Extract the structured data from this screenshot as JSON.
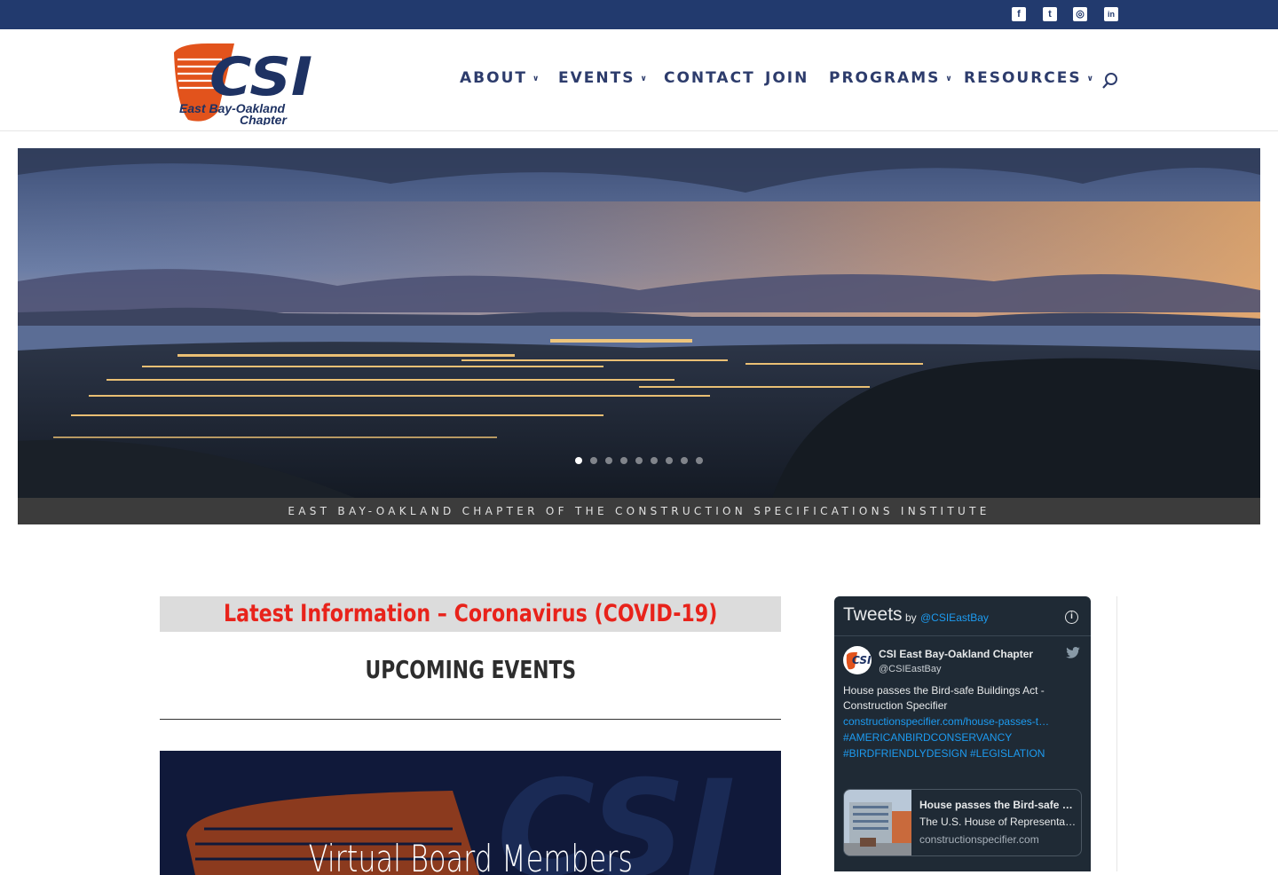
{
  "social_links": [
    {
      "icon": "facebook-icon",
      "glyph": "f"
    },
    {
      "icon": "twitter-icon",
      "glyph": "t"
    },
    {
      "icon": "instagram-icon",
      "glyph": "◎"
    },
    {
      "icon": "linkedin-icon",
      "glyph": "in"
    }
  ],
  "logo": {
    "acronym": "CSI",
    "line1": "East Bay-Oakland",
    "line2": "Chapter"
  },
  "nav": {
    "about": "ABOUT",
    "events": "EVENTS",
    "contact": "CONTACT",
    "join": "JOIN",
    "programs": "PROGRAMS",
    "resources": "RESOURCES",
    "chevron": "∨"
  },
  "hero": {
    "slide_count": 9,
    "active_slide": 1,
    "caption": "EAST BAY-OAKLAND CHAPTER OF THE CONSTRUCTION SPECIFICATIONS INSTITUTE"
  },
  "main": {
    "alert": "Latest Information – Coronavirus (COVID-19)",
    "upcoming_heading": "UPCOMING EVENTS",
    "event_title": "Virtual Board Members"
  },
  "twitter": {
    "title": "Tweets",
    "by": "by",
    "handle_link": "@CSIEastBay",
    "account_name": "CSI East Bay-Oakland Chapter",
    "account_handle": "@CSIEastBay",
    "tweet_text": "House passes the Bird-safe Buildings Act - Construction Specifier",
    "tweet_url": "constructionspecifier.com/house-passes-t…",
    "hashtag1": "#AMERICANBIRDCONSERVANCY",
    "hashtag2": "#BIRDFRIENDLYDESIGN",
    "hashtag3": "#LEGISLATION",
    "card_title": "House passes the Bird-safe Buildings Act - Construction Specifier",
    "card_desc": "The U.S. House of Representatives passed the Bird-safe Buildings Act",
    "card_domain": "constructionspecifier.com"
  },
  "colors": {
    "topbar": "#223a6e",
    "nav_text": "#2d3c6c",
    "alert_text": "#e8231b",
    "twitter_bg": "#1f2a35",
    "twitter_link": "#1d9bf0"
  }
}
